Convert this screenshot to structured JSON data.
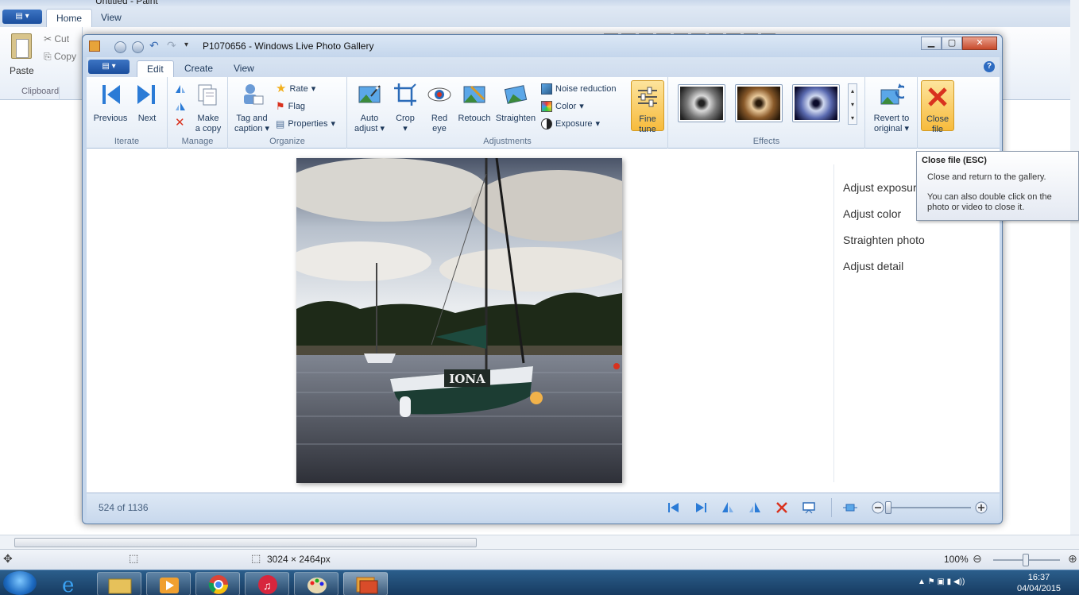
{
  "paint": {
    "title_partial": "Untitled - Paint",
    "tabs": [
      "Home",
      "View"
    ],
    "clipboard": {
      "paste": "Paste",
      "cut": "Cut",
      "copy": "Copy",
      "group": "Clipboard"
    },
    "status": {
      "dimensions": "3024 × 2464px",
      "zoom": "100%"
    }
  },
  "window": {
    "title": "P1070656 - Windows Live Photo Gallery",
    "tabs": [
      "Edit",
      "Create",
      "View"
    ],
    "active_tab": "Edit"
  },
  "ribbon": {
    "iterate": {
      "previous": "Previous",
      "next": "Next",
      "group": "Iterate"
    },
    "manage": {
      "make_copy_1": "Make",
      "make_copy_2": "a copy",
      "group": "Manage"
    },
    "organize": {
      "tag_1": "Tag and",
      "tag_2": "caption",
      "rate": "Rate",
      "flag": "Flag",
      "properties": "Properties",
      "group": "Organize"
    },
    "adjustments": {
      "auto_1": "Auto",
      "auto_2": "adjust",
      "crop": "Crop",
      "red_1": "Red",
      "red_2": "eye",
      "retouch": "Retouch",
      "straighten": "Straighten",
      "noise": "Noise reduction",
      "color": "Color",
      "exposure": "Exposure",
      "fine_1": "Fine",
      "fine_2": "tune",
      "group": "Adjustments"
    },
    "effects": {
      "group": "Effects"
    },
    "revert_1": "Revert to",
    "revert_2": "original",
    "close_1": "Close",
    "close_2": "file"
  },
  "side_panel": [
    "Adjust exposure",
    "Adjust color",
    "Straighten photo",
    "Adjust detail"
  ],
  "photo": {
    "boat_name": "IONA"
  },
  "bottom_bar": {
    "count": "524 of 1136"
  },
  "tooltip": {
    "title": "Close file (ESC)",
    "line1": "Close and return to the gallery.",
    "line2": "You can also double click on the photo or video to close it."
  },
  "taskbar": {
    "time": "16:37",
    "date": "04/04/2015"
  },
  "colors": {
    "accent": "#f7bb3c",
    "close": "#d9321e",
    "ribbon_blue": "#1e395b"
  }
}
